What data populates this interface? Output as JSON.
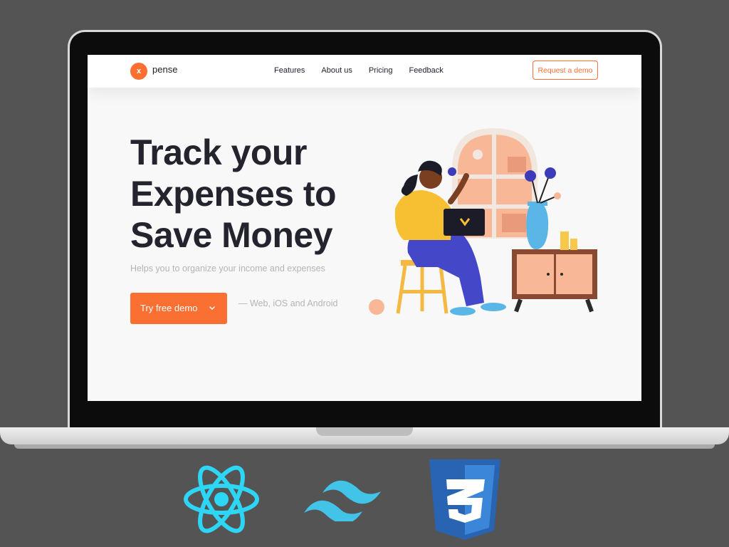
{
  "site": {
    "logo": {
      "mark": "x",
      "name": "pense"
    },
    "nav": [
      "Features",
      "About us",
      "Pricing",
      "Feedback"
    ],
    "request_demo": "Request a demo",
    "hero": {
      "title_lines": [
        "Track your",
        "Expenses to",
        "Save Money"
      ],
      "subtitle": "Helps you to organize your income and expenses",
      "cta": "Try free demo",
      "platforms": "— Web, iOS and Android"
    }
  },
  "tech_icons": [
    "react-icon",
    "tailwind-icon",
    "css3-icon"
  ],
  "colors": {
    "accent": "#fa6f32",
    "heading": "#24242e",
    "muted": "#b4b4b8",
    "background": "#545454",
    "react": "#2ed6f6",
    "tailwind": "#41c4e8",
    "css3": "#2864b2"
  }
}
